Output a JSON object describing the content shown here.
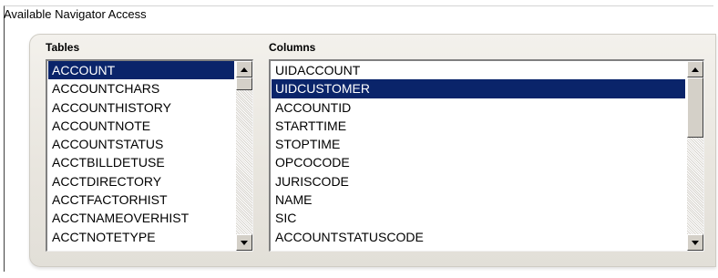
{
  "group": {
    "title": "Available Navigator Access"
  },
  "tables": {
    "label": "Tables",
    "items": [
      "ACCOUNT",
      "ACCOUNTCHARS",
      "ACCOUNTHISTORY",
      "ACCOUNTNOTE",
      "ACCOUNTSTATUS",
      "ACCTBILLDETUSE",
      "ACCTDIRECTORY",
      "ACCTFACTORHIST",
      "ACCTNAMEOVERHIST",
      "ACCTNOTETYPE"
    ],
    "selected": "ACCOUNT"
  },
  "columns": {
    "label": "Columns",
    "items": [
      "UIDACCOUNT",
      "UIDCUSTOMER",
      "ACCOUNTID",
      "STARTTIME",
      "STOPTIME",
      "OPCOCODE",
      "JURISCODE",
      "NAME",
      "SIC",
      "ACCOUNTSTATUSCODE"
    ],
    "selected": "UIDCUSTOMER"
  },
  "icons": {
    "scroll_up": "arrow-up-icon",
    "scroll_down": "arrow-down-icon"
  },
  "colors": {
    "selection": "#0a246a",
    "selection_text": "#ffffff",
    "panel": "#ebe8e1"
  }
}
